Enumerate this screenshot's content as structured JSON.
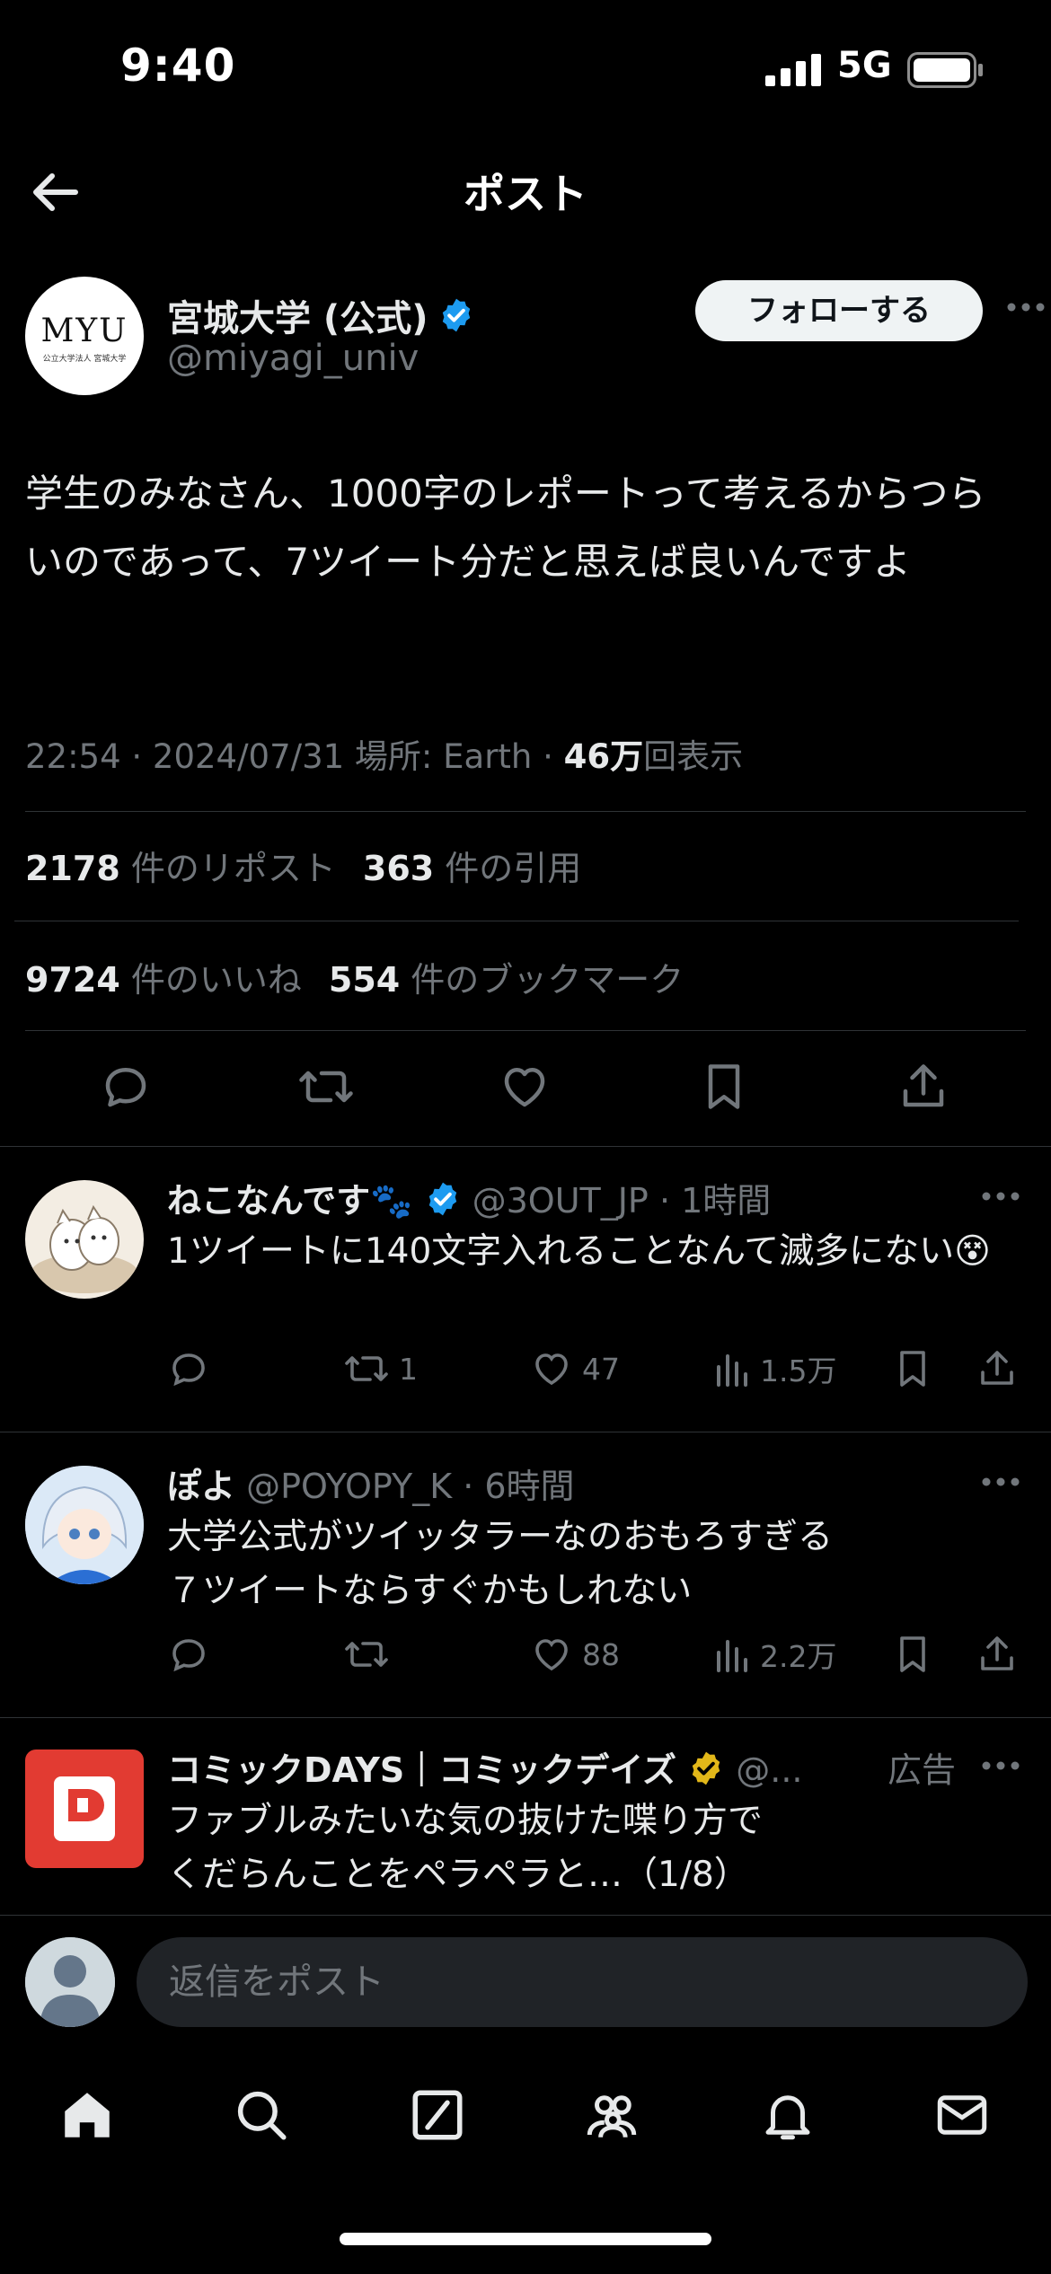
{
  "status_bar": {
    "time": "9:40",
    "network": "5G"
  },
  "header": {
    "title": "ポスト"
  },
  "post": {
    "author_name": "宮城大学 (公式)",
    "author_handle": "@miyagi_univ",
    "avatar_text": "MYU",
    "avatar_subtext": "公立大学法人 宮城大学",
    "follow_label": "フォローする",
    "text": "学生のみなさん、1000字のレポートって考えるからつらいのであって、7ツイート分だと思えば良いんですよ",
    "meta_prefix": "22:54 · 2024/07/31 場所: Earth · ",
    "views_count": "46万",
    "views_label": "回表示",
    "reposts_count": "2178",
    "reposts_label": "件のリポスト",
    "quotes_count": "363",
    "quotes_label": "件の引用",
    "likes_count": "9724",
    "likes_label": "件のいいね",
    "bookmarks_count": "554",
    "bookmarks_label": "件のブックマーク"
  },
  "replies": [
    {
      "name": "ねこなんです🐾",
      "handle": "@3OUT_JP",
      "time": "· 1時間",
      "text": "1ツイートに140文字入れることなんて滅多にない😵",
      "retweets": "1",
      "likes": "47",
      "views": "1.5万"
    },
    {
      "name": "ぽよ",
      "handle": "@POYOPY_K",
      "time": "· 6時間",
      "text_line1": "大学公式がツイッタラーなのおもろすぎる",
      "text_line2": "７ツイートならすぐかもしれない",
      "retweets": "",
      "likes": "88",
      "views": "2.2万"
    },
    {
      "name": "コミックDAYS｜コミックデイズ",
      "handle": "@...",
      "ad_label": "広告",
      "text_line1": "ファブルみたいな気の抜けた喋り方で",
      "text_line2": "くだらんことをペラペラと…（1/8）"
    }
  ],
  "reply_bar": {
    "placeholder": "返信をポスト"
  },
  "colors": {
    "background": "#000000",
    "muted": "#71767b",
    "verified_blue": "#1d9bf0",
    "verified_gold": "#e2b719"
  }
}
